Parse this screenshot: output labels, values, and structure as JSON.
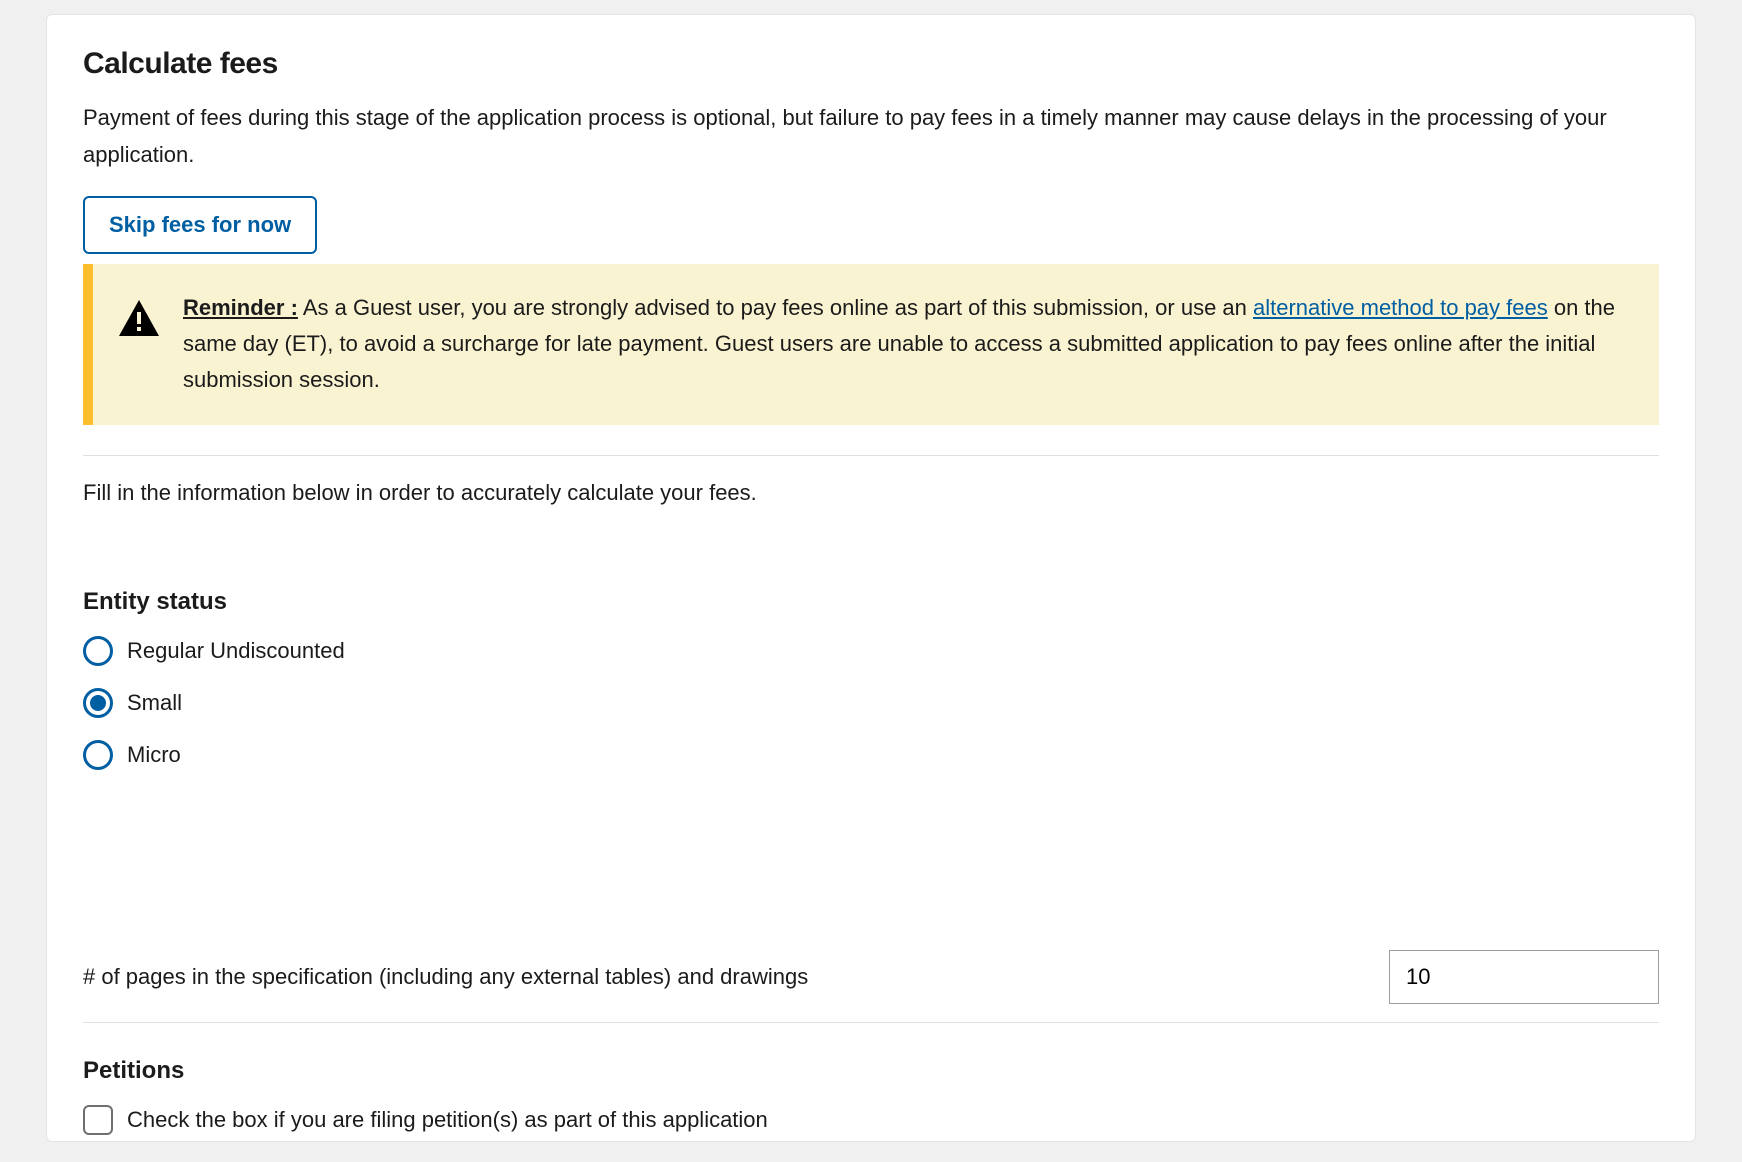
{
  "header": {
    "title": "Calculate fees",
    "intro": "Payment of fees during this stage of the application process is optional, but failure to pay fees in a timely manner may cause delays in the processing of your application.",
    "skip_label": "Skip fees for now"
  },
  "alert": {
    "reminder_label": "Reminder :",
    "text_before": " As a Guest user, you are strongly advised to pay fees online as part of this submission, or use an ",
    "link_text": "alternative method to pay fees",
    "text_after": " on the same day (ET), to avoid a surcharge for late payment. Guest users are unable to access a submitted application to pay fees online after the initial submission session."
  },
  "instruction": "Fill in the information below in order to accurately calculate your fees.",
  "entity_status": {
    "heading": "Entity status",
    "options": [
      {
        "label": "Regular Undiscounted",
        "selected": false
      },
      {
        "label": "Small",
        "selected": true
      },
      {
        "label": "Micro",
        "selected": false
      }
    ]
  },
  "pages_field": {
    "label": "# of pages in the specification (including any external tables) and drawings",
    "value": "10"
  },
  "petitions": {
    "heading": "Petitions",
    "checkbox_label": "Check the box if you are filing petition(s) as part of this application",
    "checked": false
  }
}
